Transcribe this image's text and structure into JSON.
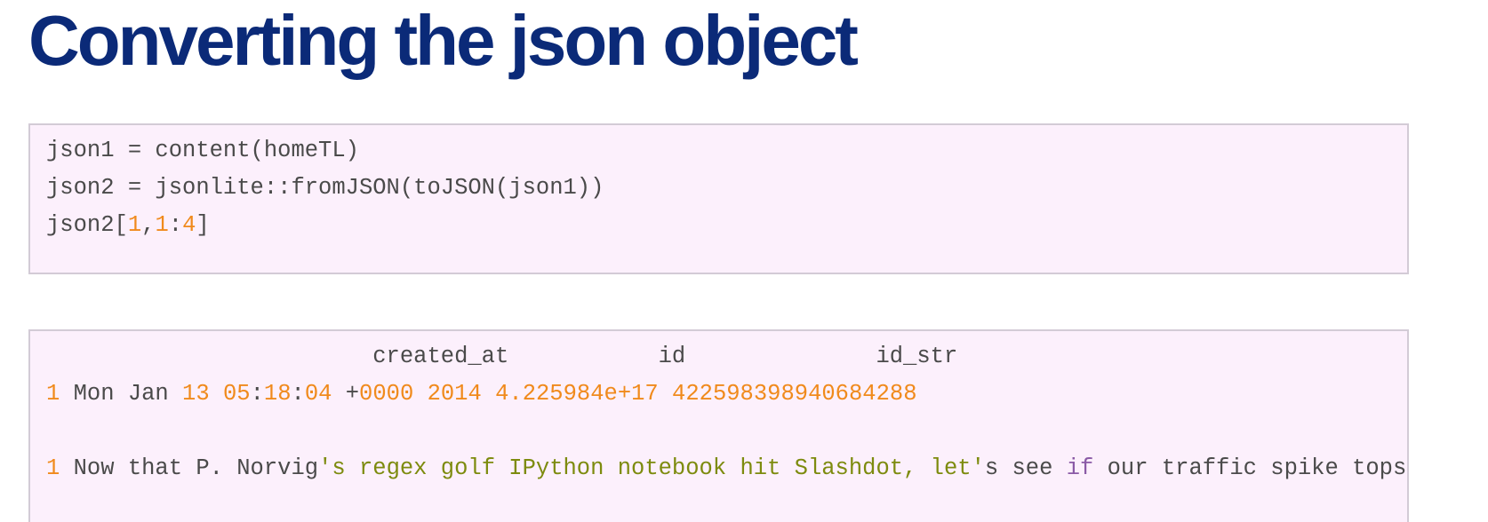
{
  "slide": {
    "title": "Converting the json object"
  },
  "code_block": {
    "lines": [
      {
        "pre": "json1 = content(homeTL)"
      },
      {
        "pre": "json2 = jsonlite::fromJSON(toJSON(json1))"
      },
      {
        "pre": "json2[",
        "n1": "1",
        "sep1": ",",
        "n2": "1",
        "sep2": ":",
        "n3": "4",
        "post": "]"
      }
    ]
  },
  "output_block": {
    "header": "                        created_at           id              id_str",
    "row1": {
      "idx": "1",
      "day": " Mon Jan ",
      "date": "13",
      "sp1": " ",
      "hh": "05",
      "c1": ":",
      "mm": "18",
      "c2": ":",
      "ss": "04",
      "sp2": " +",
      "tz": "0000",
      "sp3": " ",
      "year": "2014",
      "sp4": " ",
      "id": "4.225984e+17",
      "sp5": " ",
      "id_str": "422598398940684288"
    },
    "row2": {
      "idx": "1",
      "t1": " Now that P. Norvig",
      "s1": "'s regex golf IPython notebook hit Slashdot, let'",
      "t2": "s see ",
      "k1": "if",
      "t3": " our traffic spike tops th"
    }
  }
}
